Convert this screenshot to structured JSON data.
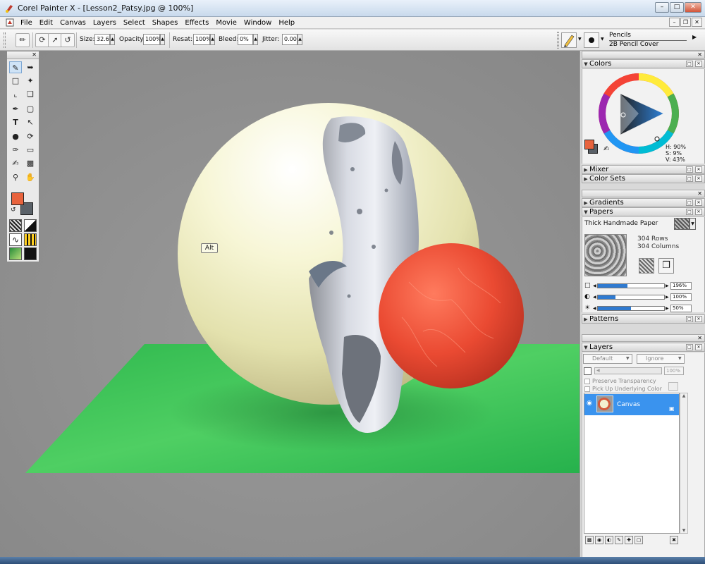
{
  "window": {
    "title": "Corel Painter X - [Lesson2_Patsy.jpg @ 100%]"
  },
  "menu": [
    "File",
    "Edit",
    "Canvas",
    "Layers",
    "Select",
    "Shapes",
    "Effects",
    "Movie",
    "Window",
    "Help"
  ],
  "propbar": {
    "size_label": "Size:",
    "size_value": "32.6",
    "opacity_label": "Opacity:",
    "opacity_value": "100%",
    "resat_label": "Resat:",
    "resat_value": "100%",
    "bleed_label": "Bleed:",
    "bleed_value": "0%",
    "jitter_label": "Jitter:",
    "jitter_value": "0.00"
  },
  "brush": {
    "category": "Pencils",
    "variant": "2B Pencil Cover"
  },
  "tooltip": "Alt",
  "colors_panel": {
    "title": "Colors",
    "h": "H: 90%",
    "s": "S: 9%",
    "v": "V: 43%",
    "main_color": "#e8633d",
    "additional_color": "#5a6168"
  },
  "panels": {
    "mixer": "Mixer",
    "color_sets": "Color Sets",
    "gradients": "Gradients",
    "papers": "Papers",
    "patterns": "Patterns",
    "layers": "Layers"
  },
  "papers": {
    "name": "Thick Handmade Paper",
    "rows": "304 Rows",
    "columns": "304 Columns",
    "scale": "196%",
    "scale_level": 0.45,
    "contrast": "100%",
    "contrast_level": 0.27,
    "brightness": "50%",
    "brightness_level": 0.5
  },
  "layers": {
    "composite_method": "Default",
    "composite_depth": "Ignore",
    "opacity": "100%",
    "preserve_transparency": "Preserve Transparency",
    "pick_up_underlying": "Pick Up Underlying Color",
    "items": [
      {
        "name": "Canvas"
      }
    ]
  },
  "icons": {
    "toolbox": [
      "brush-icon",
      "layer-adjuster-icon",
      "rect-select-icon",
      "magic-wand-icon",
      "crop-icon",
      "transform-icon",
      "pen-icon",
      "rectangle-shape-icon",
      "text-icon",
      "selection-adjuster-icon",
      "dodge-icon",
      "lasso-icon",
      "dropper-brush-icon",
      "eraser-icon",
      "eyedropper-icon",
      "paint-bucket-icon",
      "magnifier-icon",
      "grabber-icon"
    ]
  }
}
